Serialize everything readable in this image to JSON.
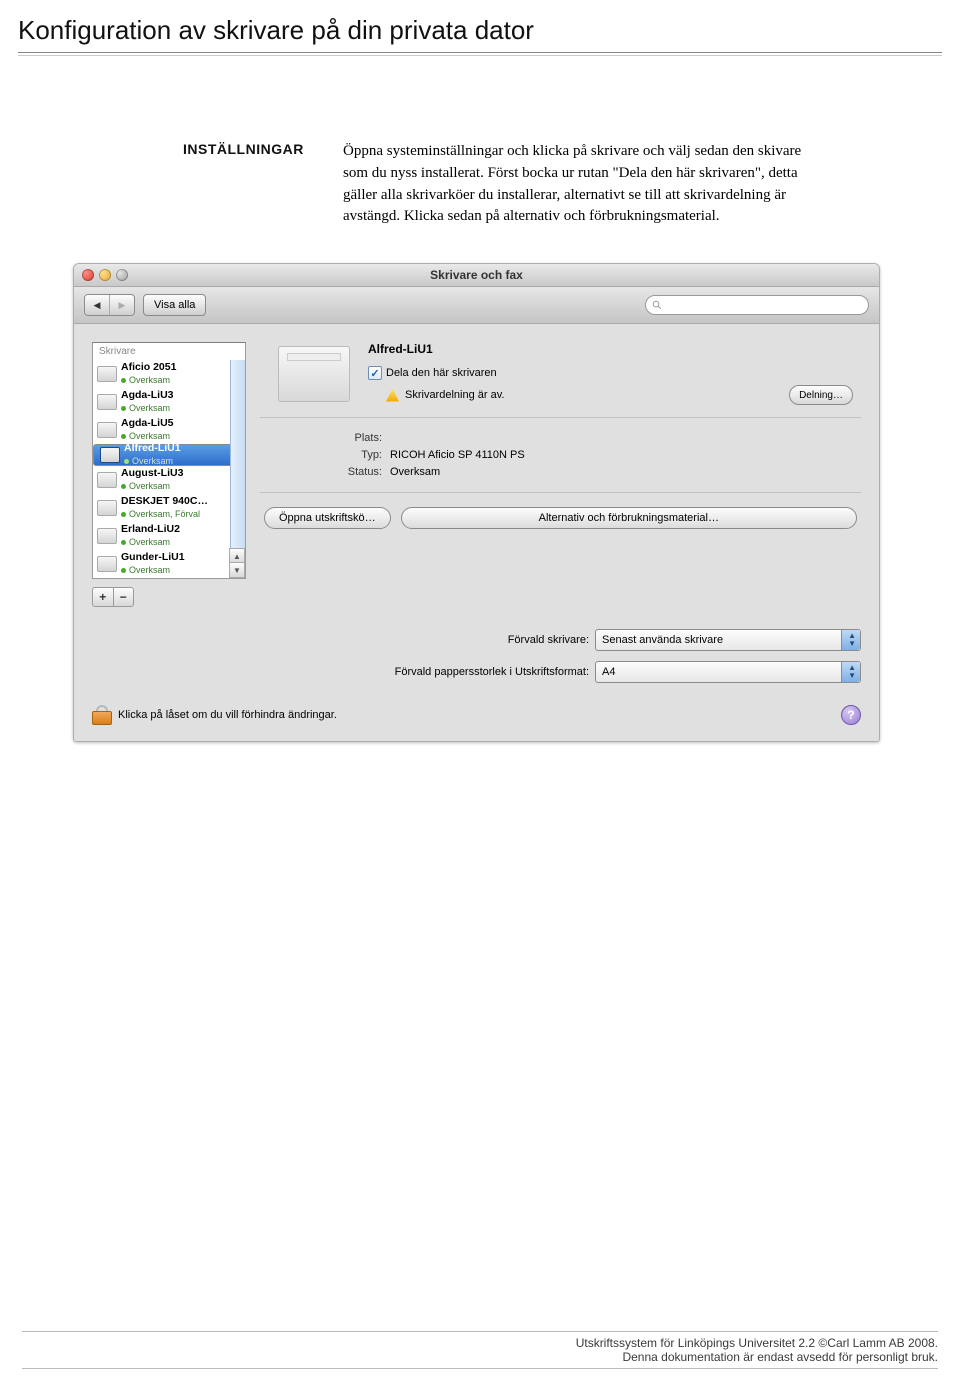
{
  "doc_title": "Konfiguration av skrivare på din privata dator",
  "section_label": "INSTÄLLNINGAR",
  "body_text": "Öppna systeminställningar och klicka på skrivare och välj sedan den skivare som du nyss installerat. Först bocka ur rutan \"Dela den här skrivaren\", detta gäller alla skrivarköer du installerar, alternativt se till att skrivardelning är avstängd. Klicka sedan på alternativ och förbrukningsmaterial.",
  "window": {
    "title": "Skrivare och fax",
    "show_all": "Visa alla",
    "search_placeholder": ""
  },
  "sidebar": {
    "header": "Skrivare"
  },
  "printers": [
    {
      "name": "Aficio 2051",
      "status": "Overksam",
      "selected": false
    },
    {
      "name": "Agda-LiU3",
      "status": "Overksam",
      "selected": false
    },
    {
      "name": "Agda-LiU5",
      "status": "Overksam",
      "selected": false
    },
    {
      "name": "Alfred-LiU1",
      "status": "Overksam",
      "selected": true
    },
    {
      "name": "August-LiU3",
      "status": "Overksam",
      "selected": false
    },
    {
      "name": "DESKJET 940C…",
      "status": "Overksam, Förval",
      "selected": false
    },
    {
      "name": "Erland-LiU2",
      "status": "Overksam",
      "selected": false
    },
    {
      "name": "Gunder-LiU1",
      "status": "Overksam",
      "selected": false
    }
  ],
  "detail": {
    "name": "Alfred-LiU1",
    "share_label": "Dela den här skrivaren",
    "share_off_warning": "Skrivardelning är av.",
    "share_button": "Delning…",
    "labels": {
      "plats": "Plats:",
      "typ": "Typ:",
      "status": "Status:"
    },
    "plats": "",
    "typ": "RICOH Aficio SP 4110N PS",
    "status": "Overksam",
    "open_queue": "Öppna utskriftskö…",
    "options_supplies": "Alternativ och förbrukningsmaterial…"
  },
  "defaults": {
    "default_printer_label": "Förvald skrivare:",
    "default_printer_value": "Senast använda skrivare",
    "paper_label": "Förvald pappersstorlek i Utskriftsformat:",
    "paper_value": "A4"
  },
  "lock_text": "Klicka på låset om du vill förhindra ändringar.",
  "footer_line1": "Utskriftssystem för Linköpings Universitet 2.2 ©Carl Lamm AB 2008.",
  "footer_line2": "Denna dokumentation är endast avsedd för personligt bruk."
}
